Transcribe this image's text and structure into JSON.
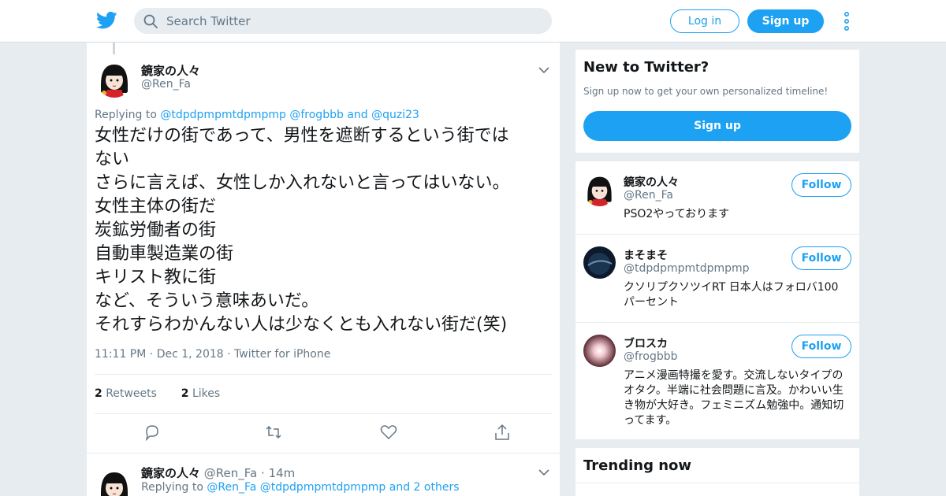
{
  "header": {
    "search_placeholder": "Search Twitter",
    "login_label": "Log in",
    "signup_label": "Sign up",
    "accent": "#1da1f2"
  },
  "tweet": {
    "display_name": "鏡家の人々",
    "handle": "@Ren_Fa",
    "replying_to_prefix": "Replying to",
    "replying_to": [
      "@tdpdpmpmtdpmpmp",
      "@frogbbb",
      "and",
      "@quzi23"
    ],
    "text_lines": [
      "女性だけの街であって、男性を遮断するという街では",
      "ない",
      "さらに言えば、女性しか入れないと言ってはいない。",
      "女性主体の街だ",
      "炭鉱労働者の街",
      "自動車製造業の街",
      "キリスト教に街",
      "など、そういう意味あいだ。",
      "それすらわかんない人は少なくとも入れない街だ(笑)"
    ],
    "time": "11:11 PM",
    "date": "Dec 1, 2018",
    "source": "Twitter for iPhone",
    "retweets_count": "2",
    "retweets_label": "Retweets",
    "likes_count": "2",
    "likes_label": "Likes"
  },
  "reply": {
    "display_name": "鏡家の人々",
    "handle": "@Ren_Fa",
    "time": "14m",
    "replying_to_prefix": "Replying to",
    "replying_to": [
      "@Ren_Fa",
      "@tdpdpmpmtdpmpmp",
      "and 2 others"
    ]
  },
  "sidebar": {
    "new_title": "New to Twitter?",
    "new_subtitle": "Sign up now to get your own personalized timeline!",
    "new_signup": "Sign up",
    "follow_label": "Follow",
    "users": [
      {
        "name": "鏡家の人々",
        "handle": "@Ren_Fa",
        "bio": "PSO2やっております"
      },
      {
        "name": "まそまそ",
        "handle": "@tdpdpmpmtdpmpmp",
        "bio": "クソリプクソツイRT 日本人はフォロバ100パーセント"
      },
      {
        "name": "ブロスカ",
        "handle": "@frogbbb",
        "bio": "アニメ漫画特撮を愛す。交流しないタイプのオタク。半端に社会問題に言及。かわいい生き物が大好き。フェミニズム勉強中。通知切ってます。"
      }
    ],
    "trending_title": "Trending now"
  }
}
